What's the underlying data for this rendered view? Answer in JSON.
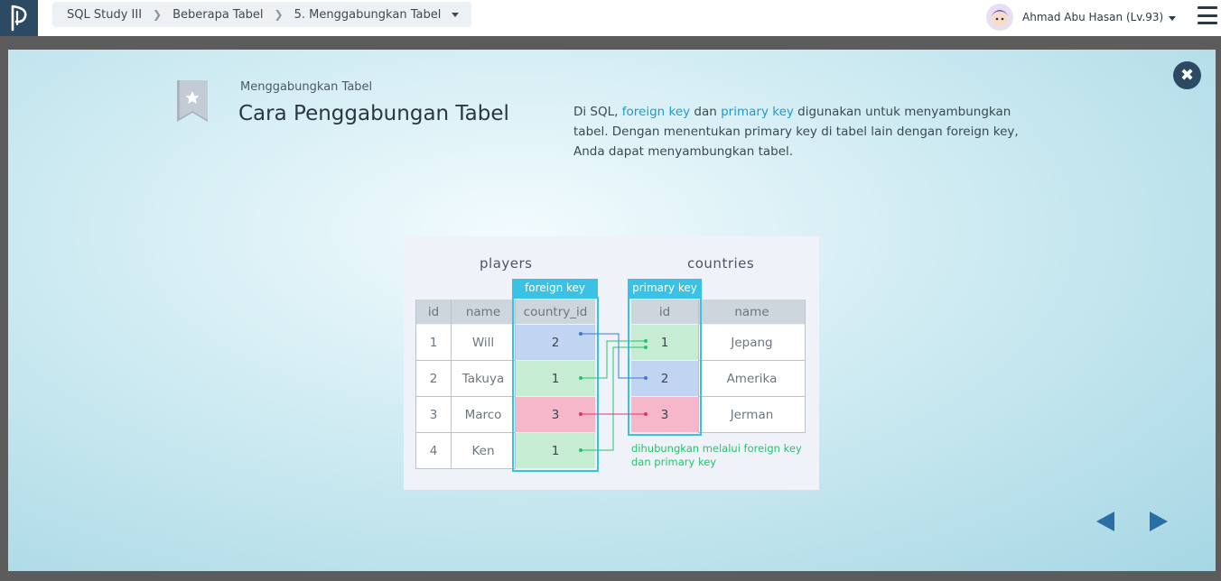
{
  "breadcrumb": {
    "items": [
      "SQL Study III",
      "Beberapa Tabel",
      "5. Menggabungkan Tabel"
    ]
  },
  "user": {
    "name": "Ahmad Abu Hasan (Lv.93)"
  },
  "slide": {
    "subtitle": "Menggabungkan Tabel",
    "title": "Cara Penggabungan Tabel",
    "desc": {
      "p1": "Di SQL, ",
      "foreign_key": "foreign key",
      "p2": " dan ",
      "primary_key": "primary key",
      "p3": " digunakan untuk menyambungkan tabel. Dengan menentukan primary key di tabel lain dengan foreign key, Anda dapat menyambungkan tabel."
    }
  },
  "diagram": {
    "players": {
      "title": "players",
      "key_label": "foreign key",
      "headers": [
        "id",
        "name",
        "country_id"
      ],
      "rows": [
        {
          "id": "1",
          "name": "Will",
          "country_id": "2"
        },
        {
          "id": "2",
          "name": "Takuya",
          "country_id": "1"
        },
        {
          "id": "3",
          "name": "Marco",
          "country_id": "3"
        },
        {
          "id": "4",
          "name": "Ken",
          "country_id": "1"
        }
      ]
    },
    "countries": {
      "title": "countries",
      "key_label": "primary key",
      "headers": [
        "id",
        "name"
      ],
      "rows": [
        {
          "id": "1",
          "name": "Jepang"
        },
        {
          "id": "2",
          "name": "Amerika"
        },
        {
          "id": "3",
          "name": "Jerman"
        }
      ]
    },
    "note_line1": "dihubungkan melalui foreign key",
    "note_line2": "dan primary key"
  },
  "colors": {
    "accent": "#39c2e6",
    "link_blue": "#3a78d8",
    "link_green": "#25c46a",
    "link_pink": "#e0336e",
    "navy": "#2c4a63"
  },
  "icons": {
    "logo": "progate-logo-icon",
    "close": "close-icon",
    "menu": "hamburger-menu-icon",
    "bookmark": "star-bookmark-icon",
    "prev": "prev-arrow-icon",
    "next": "next-arrow-icon"
  }
}
